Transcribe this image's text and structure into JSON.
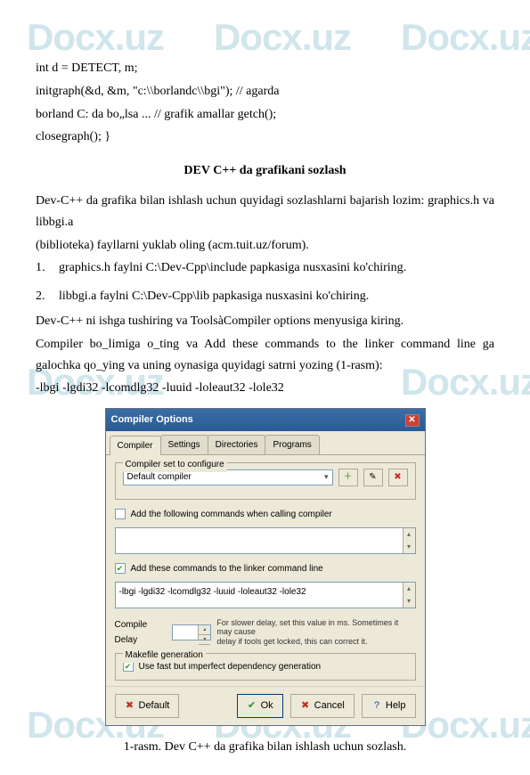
{
  "watermark": "Docx.uz",
  "code": {
    "l1": "int d = DETECT, m;",
    "l2": "initgraph(&d, &m, \"c:\\\\borlandc\\\\bgi\"); // agarda",
    "l3": "borland C: da bo„lsa ... // grafik amallar getch();",
    "l4": "closegraph(); }"
  },
  "heading1": "DEV C++ da grafikani sozlash",
  "p1": "Dev-C++ da grafika bilan ishlash uchun quyidagi sozlashlarni bajarish lozim: graphics.h va libbgi.a",
  "p2": "(biblioteka) fayllarni yuklab oling (acm.tuit.uz/forum).",
  "li1_num": "1.",
  "li1": "graphics.h faylni C:\\Dev-Cpp\\include papkasiga nusxasini ko'chiring.",
  "li2_num": "2.",
  "li2": "libbgi.a faylni C:\\Dev-Cpp\\lib papkasiga nusxasini ko'chiring.",
  "p3": "Dev-C++ ni ishga tushiring va ToolsàCompiler options menyusiga kiring.",
  "p4": "Compiler bo_limiga o_ting va Add these commands to the linker command line ga galochka qo_ying va uning oynasiga quyidagi satrni yozing (1-rasm):",
  "p5": "-lbgi -lgdi32 -lcomdlg32 -luuid -loleaut32 -lole32",
  "dialog": {
    "title": "Compiler Options",
    "tabs": [
      "Compiler",
      "Settings",
      "Directories",
      "Programs"
    ],
    "section_label": "Compiler set to configure",
    "compiler_set": "Default compiler",
    "chk1_label": "Add the following commands when calling compiler",
    "chk2_label": "Add these commands to the linker command line",
    "linker_value": "-lbgi -lgdi32 -lcomdlg32 -luuid -loleaut32 -lole32",
    "delay_label": "Compile Delay",
    "delay_note1": "For slower delay, set this value in ms. Sometimes it may cause",
    "delay_note2": "delay if tools get locked, this can correct it.",
    "group_title": "Makefile generation",
    "chk3_label": "Use fast but imperfect dependency generation",
    "btn_default": "Default",
    "btn_ok": "Ok",
    "btn_cancel": "Cancel",
    "btn_help": "Help"
  },
  "caption": "1-rasm. Dev C++ da grafika bilan ishlash uchun sozlash."
}
